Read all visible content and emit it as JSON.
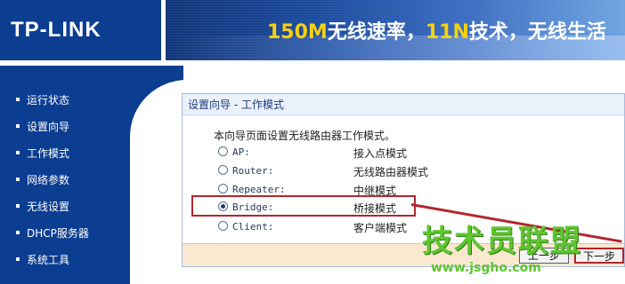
{
  "header": {
    "logo": "TP-LINK",
    "slogan_parts": [
      "150M",
      "无线速率，",
      "11N",
      "技术，无线生活"
    ]
  },
  "sidebar": {
    "items": [
      {
        "label": "运行状态"
      },
      {
        "label": "设置向导"
      },
      {
        "label": "工作模式"
      },
      {
        "label": "网络参数"
      },
      {
        "label": "无线设置"
      },
      {
        "label": "DHCP服务器"
      },
      {
        "label": "系统工具"
      }
    ]
  },
  "panel": {
    "title": "设置向导 - 工作模式",
    "description": "本向导页面设置无线路由器工作模式。",
    "modes": [
      {
        "label": "AP:",
        "desc": "接入点模式",
        "checked": false
      },
      {
        "label": "Router:",
        "desc": "无线路由器模式",
        "checked": false
      },
      {
        "label": "Repeater:",
        "desc": "中继模式",
        "checked": false
      },
      {
        "label": "Bridge:",
        "desc": "桥接模式",
        "checked": true
      },
      {
        "label": "Client:",
        "desc": "客户端模式",
        "checked": false
      }
    ],
    "prev_label": "上一步",
    "next_label": "下一步"
  },
  "watermark": {
    "title": "技术员联盟",
    "url": "www.jsgho.com"
  },
  "colors": {
    "sidebar": "#0b3d91",
    "highlight": "#b3262d",
    "watermark": "#5fc52f"
  }
}
